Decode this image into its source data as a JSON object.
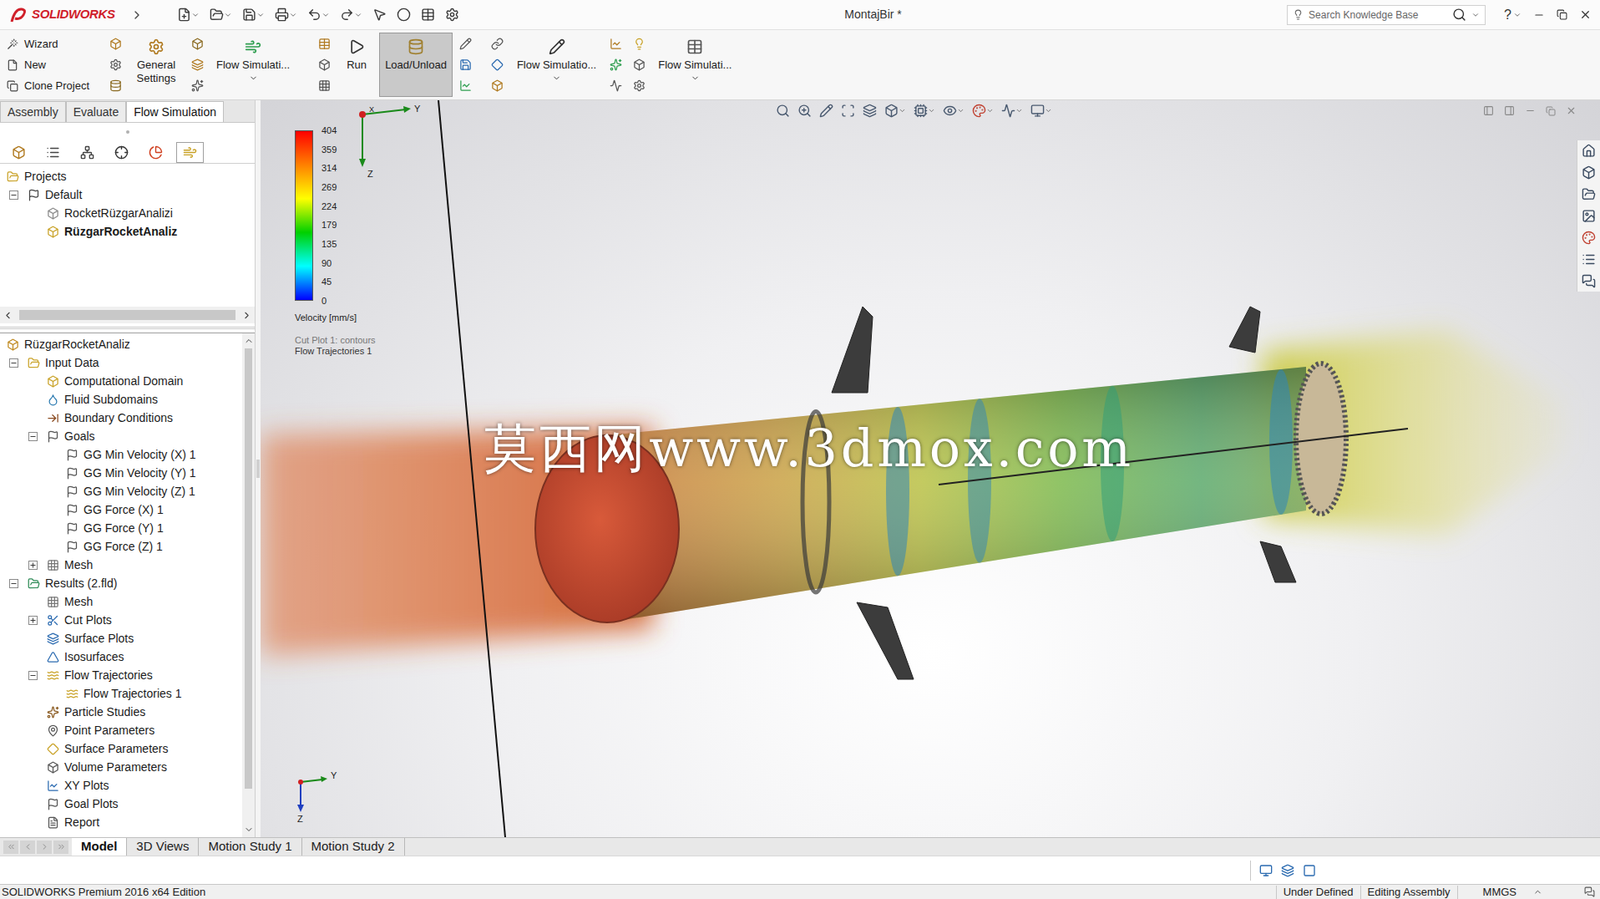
{
  "window": {
    "logo": "SOLIDWORKS",
    "title": "MontajBir *",
    "search_placeholder": "Search Knowledge Base",
    "help": "?"
  },
  "ribbon": {
    "stack": [
      "Wizard",
      "New",
      "Clone Project"
    ],
    "buttons": [
      {
        "label": "General Settings",
        "selected": false,
        "dropdown": false
      },
      {
        "label": "Flow Simulati...",
        "selected": false,
        "dropdown": true
      },
      {
        "label": "Run",
        "selected": false,
        "dropdown": false
      },
      {
        "label": "Load/Unload",
        "selected": true,
        "dropdown": false
      },
      {
        "label": "Flow Simulatio...",
        "selected": false,
        "dropdown": true
      },
      {
        "label": "Flow Simulati...",
        "selected": false,
        "dropdown": true
      }
    ]
  },
  "command_tabs": [
    {
      "label": "Assembly",
      "selected": false
    },
    {
      "label": "Evaluate",
      "selected": false
    },
    {
      "label": "Flow Simulation",
      "selected": true
    }
  ],
  "panel_tabs": [
    {
      "selected": false
    },
    {
      "selected": false
    },
    {
      "selected": false
    },
    {
      "selected": false
    },
    {
      "selected": false
    },
    {
      "selected": true
    }
  ],
  "projects_tree": [
    {
      "label": "Projects",
      "depth": 0,
      "kind": "folder"
    },
    {
      "label": "Default",
      "depth": 1,
      "kind": "config",
      "expanded": true
    },
    {
      "label": "RocketRüzgarAnalizi",
      "depth": 2,
      "kind": "project",
      "active": false
    },
    {
      "label": "RüzgarRocketAnaliz",
      "depth": 2,
      "kind": "project",
      "active": true
    }
  ],
  "analysis_tree": [
    {
      "label": "RüzgarRocketAnaliz",
      "depth": 0,
      "kind": "root"
    },
    {
      "label": "Input Data",
      "depth": 1,
      "kind": "input",
      "expanded": true
    },
    {
      "label": "Computational Domain",
      "depth": 2,
      "kind": "domain"
    },
    {
      "label": "Fluid Subdomains",
      "depth": 2,
      "kind": "fluid"
    },
    {
      "label": "Boundary Conditions",
      "depth": 2,
      "kind": "boundary"
    },
    {
      "label": "Goals",
      "depth": 2,
      "kind": "goals",
      "expanded": true
    },
    {
      "label": "GG Min Velocity (X) 1",
      "depth": 3,
      "kind": "goal"
    },
    {
      "label": "GG Min Velocity (Y) 1",
      "depth": 3,
      "kind": "goal"
    },
    {
      "label": "GG Min Velocity (Z) 1",
      "depth": 3,
      "kind": "goal"
    },
    {
      "label": "GG Force (X) 1",
      "depth": 3,
      "kind": "goal"
    },
    {
      "label": "GG Force (Y) 1",
      "depth": 3,
      "kind": "goal"
    },
    {
      "label": "GG Force (Z) 1",
      "depth": 3,
      "kind": "goal"
    },
    {
      "label": "Mesh",
      "depth": 2,
      "kind": "mesh",
      "expanded": false
    },
    {
      "label": "Results (2.fld)",
      "depth": 1,
      "kind": "results",
      "expanded": true
    },
    {
      "label": "Mesh",
      "depth": 2,
      "kind": "mesh"
    },
    {
      "label": "Cut Plots",
      "depth": 2,
      "kind": "cutplot",
      "expanded": false
    },
    {
      "label": "Surface Plots",
      "depth": 2,
      "kind": "surface"
    },
    {
      "label": "Isosurfaces",
      "depth": 2,
      "kind": "iso"
    },
    {
      "label": "Flow Trajectories",
      "depth": 2,
      "kind": "trajectory",
      "expanded": true
    },
    {
      "label": "Flow Trajectories 1",
      "depth": 3,
      "kind": "trajectory"
    },
    {
      "label": "Particle Studies",
      "depth": 2,
      "kind": "particle"
    },
    {
      "label": "Point Parameters",
      "depth": 2,
      "kind": "point"
    },
    {
      "label": "Surface Parameters",
      "depth": 2,
      "kind": "param"
    },
    {
      "label": "Volume Parameters",
      "depth": 2,
      "kind": "volume"
    },
    {
      "label": "XY Plots",
      "depth": 2,
      "kind": "xy"
    },
    {
      "label": "Goal Plots",
      "depth": 2,
      "kind": "goalplot"
    },
    {
      "label": "Report",
      "depth": 2,
      "kind": "report"
    }
  ],
  "legend": {
    "values": [
      "404",
      "359",
      "314",
      "269",
      "224",
      "179",
      "135",
      "90",
      "45",
      "0"
    ],
    "quantity": "Velocity [mm/s]",
    "plots": [
      "Cut Plot 1: contours",
      "Flow Trajectories 1"
    ]
  },
  "axes": {
    "top": {
      "y": "Y",
      "x": "X",
      "z": "Z"
    },
    "bottom": {
      "y": "Y",
      "z": "Z"
    }
  },
  "watermark": "莫西网www.3dmox.com",
  "bottom_tabs": [
    {
      "label": "Model",
      "selected": true
    },
    {
      "label": "3D Views",
      "selected": false
    },
    {
      "label": "Motion Study 1",
      "selected": false
    },
    {
      "label": "Motion Study 2",
      "selected": false
    }
  ],
  "status_bar": {
    "edition": "SOLIDWORKS Premium 2016 x64 Edition",
    "items": [
      "Under Defined",
      "Editing Assembly",
      "MMGS"
    ]
  }
}
